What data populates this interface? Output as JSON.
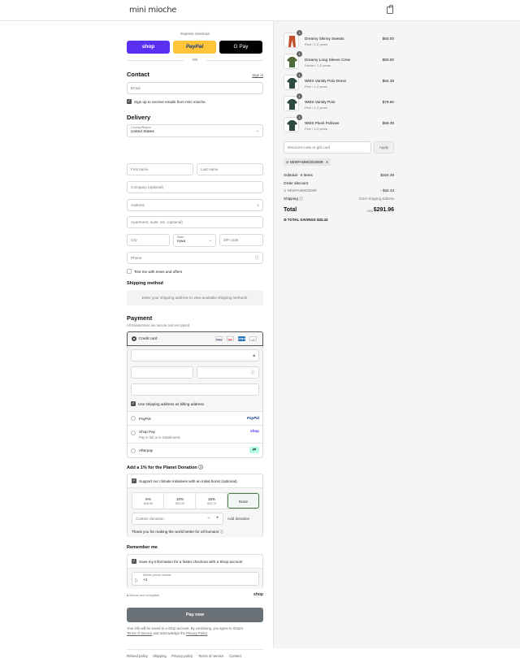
{
  "header": {
    "logo": "mini mioche",
    "cart_icon": "shopping-bag-icon"
  },
  "express": {
    "label": "Express checkout",
    "shop": "shop",
    "paypal": "PayPal",
    "gpay": "G Pay",
    "or": "OR"
  },
  "contact": {
    "title": "Contact",
    "sign_in": "Sign in",
    "email_placeholder": "Email",
    "subscribe_label": "Sign up to receive emails from mini mioche."
  },
  "delivery": {
    "title": "Delivery",
    "country_label": "Country/Region",
    "country_value": "United States",
    "first_name": "First name",
    "last_name": "Last name",
    "company": "Company (optional)",
    "address": "Address",
    "apartment": "Apartment, suite, etc. (optional)",
    "city": "City",
    "state_label": "State",
    "state_value": "Iowa",
    "zip": "ZIP code",
    "phone": "Phone",
    "text_me": "Text me with news and offers"
  },
  "shipping": {
    "title": "Shipping method",
    "message": "Enter your shipping address to view available shipping methods."
  },
  "payment": {
    "title": "Payment",
    "subtitle": "All transactions are secure and encrypted.",
    "credit_card": "Credit card",
    "card_brands": [
      "VISA",
      "MC",
      "AMEX",
      "+4"
    ],
    "use_shipping": "Use shipping address as billing address",
    "paypal": "PayPal",
    "paypal_logo": "PayPal",
    "shop_pay": "Shop Pay",
    "shop_pay_sub": "Pay in full or in installments",
    "shop_pay_logo": "shop",
    "afterpay": "Afterpay"
  },
  "donation": {
    "title": "Add a 1% for the Planet Donation",
    "support": "Support our climate initiatives with an initial boost (optional).",
    "options": [
      {
        "pct": "5%",
        "amt": "$16.60"
      },
      {
        "pct": "10%",
        "amt": "$29.20"
      },
      {
        "pct": "15%",
        "amt": "$43.79"
      },
      {
        "pct": "None",
        "amt": ""
      }
    ],
    "custom_placeholder": "Custom donation",
    "add_button": "Add donation",
    "thanks": "Thank you for making the world better for all humans"
  },
  "remember": {
    "title": "Remember me",
    "save_label": "Save my information for a faster checkout with a Shop account",
    "phone_label": "Mobile phone number",
    "phone_value": "+1",
    "secure": "Secure and encrypted",
    "shop_logo": "shop"
  },
  "pay_now": "Pay now",
  "legal": {
    "text1": "Your info will be saved to a Shop account. By continuing, you agree to Shop's",
    "terms": "Terms of Service",
    "text2": "and acknowledge the",
    "privacy": "Privacy Policy"
  },
  "footer_links": [
    "Refund policy",
    "Shipping",
    "Privacy policy",
    "Terms of service",
    "Contact"
  ],
  "cart": {
    "items": [
      {
        "name": "Dreamy Skinny Sweats",
        "variant": "Rust / 1-2 years",
        "price": "$60.00",
        "qty": "1",
        "color": "#c2522c"
      },
      {
        "name": "Dreamy Long Sleeve Crew",
        "variant": "Hunter / 1-2 years",
        "price": "$50.00",
        "qty": "1",
        "color": "#4f6a3a"
      },
      {
        "name": "WMS Varsity Polo Dress",
        "variant": "Pine / 1-2 years",
        "price": "$84.39",
        "qty": "1",
        "color": "#2c4a3e"
      },
      {
        "name": "WMS Varsity Polo",
        "variant": "Pine / 1-2 years",
        "price": "$79.60",
        "qty": "1",
        "color": "#2c4a3e"
      },
      {
        "name": "WMS Plush Pullover",
        "variant": "Pine / 1-2 years",
        "price": "$59.39",
        "qty": "1",
        "color": "#2c4a3e"
      }
    ],
    "discount_placeholder": "Discount code or gift card",
    "apply": "Apply",
    "code_tag": "NEWFAMMO2025MR",
    "subtotal_label": "Subtotal · 5 items",
    "subtotal": "$324.39",
    "order_discount": "Order discount",
    "discount_code": "NEWFAMMO25MR",
    "discount_amount": "- $32.43",
    "shipping_label": "Shipping",
    "shipping_value": "Enter shipping address",
    "total_label": "Total",
    "currency": "USD",
    "total": "$291.96",
    "savings_label": "TOTAL SAVINGS",
    "savings": "$32.43"
  }
}
